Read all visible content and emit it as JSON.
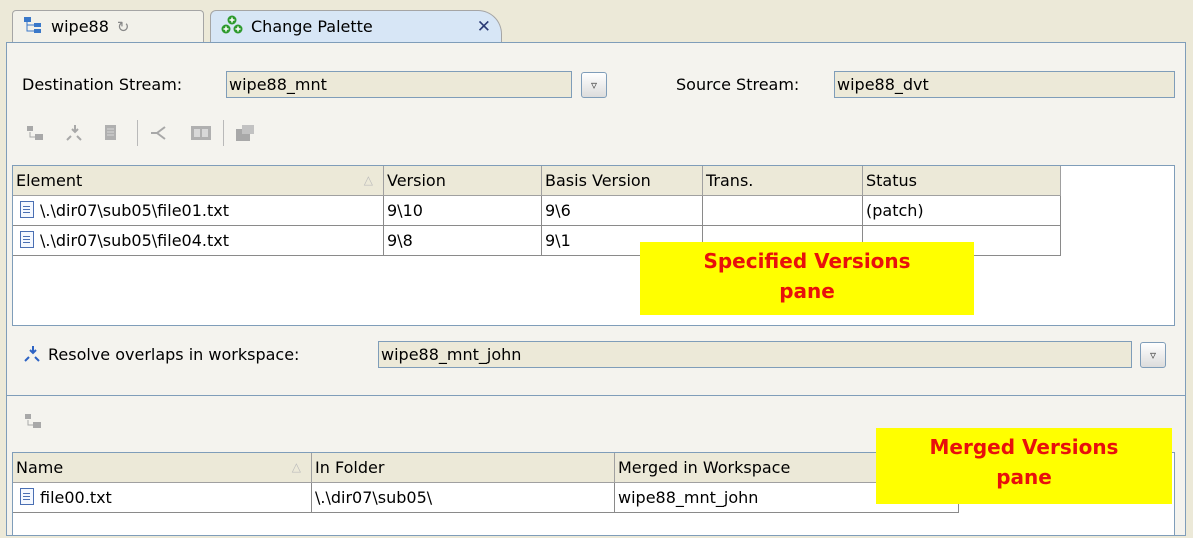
{
  "tabs": [
    {
      "label": "wipe88",
      "icon": "stream-tree-icon",
      "extra": "↻"
    },
    {
      "label": "Change Palette",
      "icon": "change-palette-icon",
      "close": "✕"
    }
  ],
  "streams": {
    "destination_label": "Destination Stream:",
    "destination_value": "wipe88_mnt",
    "source_label": "Source Stream:",
    "source_value": "wipe88_dvt",
    "dropdown_glyph": "▿"
  },
  "specified": {
    "columns": [
      "Element",
      "Version",
      "Basis Version",
      "Trans.",
      "Status"
    ],
    "sort_glyph": "△",
    "rows": [
      {
        "element": "\\.\\dir07\\sub05\\file01.txt",
        "version": "9\\10",
        "basis": "9\\6",
        "trans": "",
        "status": "(patch)"
      },
      {
        "element": "\\.\\dir07\\sub05\\file04.txt",
        "version": "9\\8",
        "basis": "9\\1",
        "trans": "",
        "status": ""
      }
    ],
    "callout": [
      "Specified Versions",
      "pane"
    ]
  },
  "resolve": {
    "label": "Resolve overlaps in workspace:",
    "value": "wipe88_mnt_john"
  },
  "merged": {
    "columns": [
      "Name",
      "In Folder",
      "Merged in Workspace"
    ],
    "sort_glyph": "△",
    "rows": [
      {
        "name": "file00.txt",
        "folder": "\\.\\dir07\\sub05\\",
        "workspace": "wipe88_mnt_john"
      }
    ],
    "callout": [
      "Merged Versions",
      "pane"
    ]
  },
  "colors": {
    "callout_bg": "#ffff00",
    "callout_text": "#e8100c",
    "border": "#7f9db9"
  }
}
